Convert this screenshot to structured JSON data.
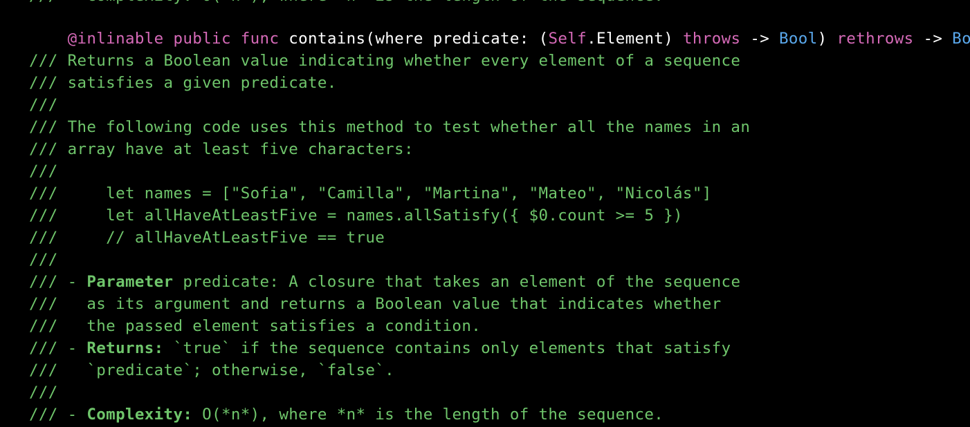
{
  "colors": {
    "background": "#000000",
    "comment": "#6fc56b",
    "keyword": "#d66ab8",
    "type": "#5aa8ec",
    "text": "#ffffff"
  },
  "top_partial_line": "/// - Complexity: O(*n*), where *n* is the length of the sequence.",
  "signature": {
    "attribute": "@inlinable",
    "public": "public",
    "func": "func",
    "name": "contains(where predicate: (",
    "self_kw": "Self",
    "element": ".Element) ",
    "throws": "throws",
    "arrow1": " -> ",
    "bool1": "Bool",
    "close": ") ",
    "rethrows": "rethrows",
    "arrow2": " -> ",
    "bool2": "Bool"
  },
  "doc_lines": [
    "/// Returns a Boolean value indicating whether every element of a sequence",
    "/// satisfies a given predicate.",
    "///",
    "/// The following code uses this method to test whether all the names in an",
    "/// array have at least five characters:",
    "///",
    "///     let names = [\"Sofia\", \"Camilla\", \"Martina\", \"Mateo\", \"Nicolás\"]",
    "///     let allHaveAtLeastFive = names.allSatisfy({ $0.count >= 5 })",
    "///     // allHaveAtLeastFive == true",
    "///"
  ],
  "param_block": {
    "prefix": "/// - ",
    "label": "Parameter",
    "rest": " predicate: A closure that takes an element of the sequence",
    "line2": "///   as its argument and returns a Boolean value that indicates whether",
    "line3": "///   the passed element satisfies a condition."
  },
  "returns_block": {
    "prefix": "/// - ",
    "label": "Returns:",
    "rest": " `true` if the sequence contains only elements that satisfy",
    "line2": "///   `predicate`; otherwise, `false`."
  },
  "blank_after_returns": "///",
  "complexity_block": {
    "prefix": "/// - ",
    "label": "Complexity:",
    "rest": " O(*n*), where *n* is the length of the sequence."
  }
}
